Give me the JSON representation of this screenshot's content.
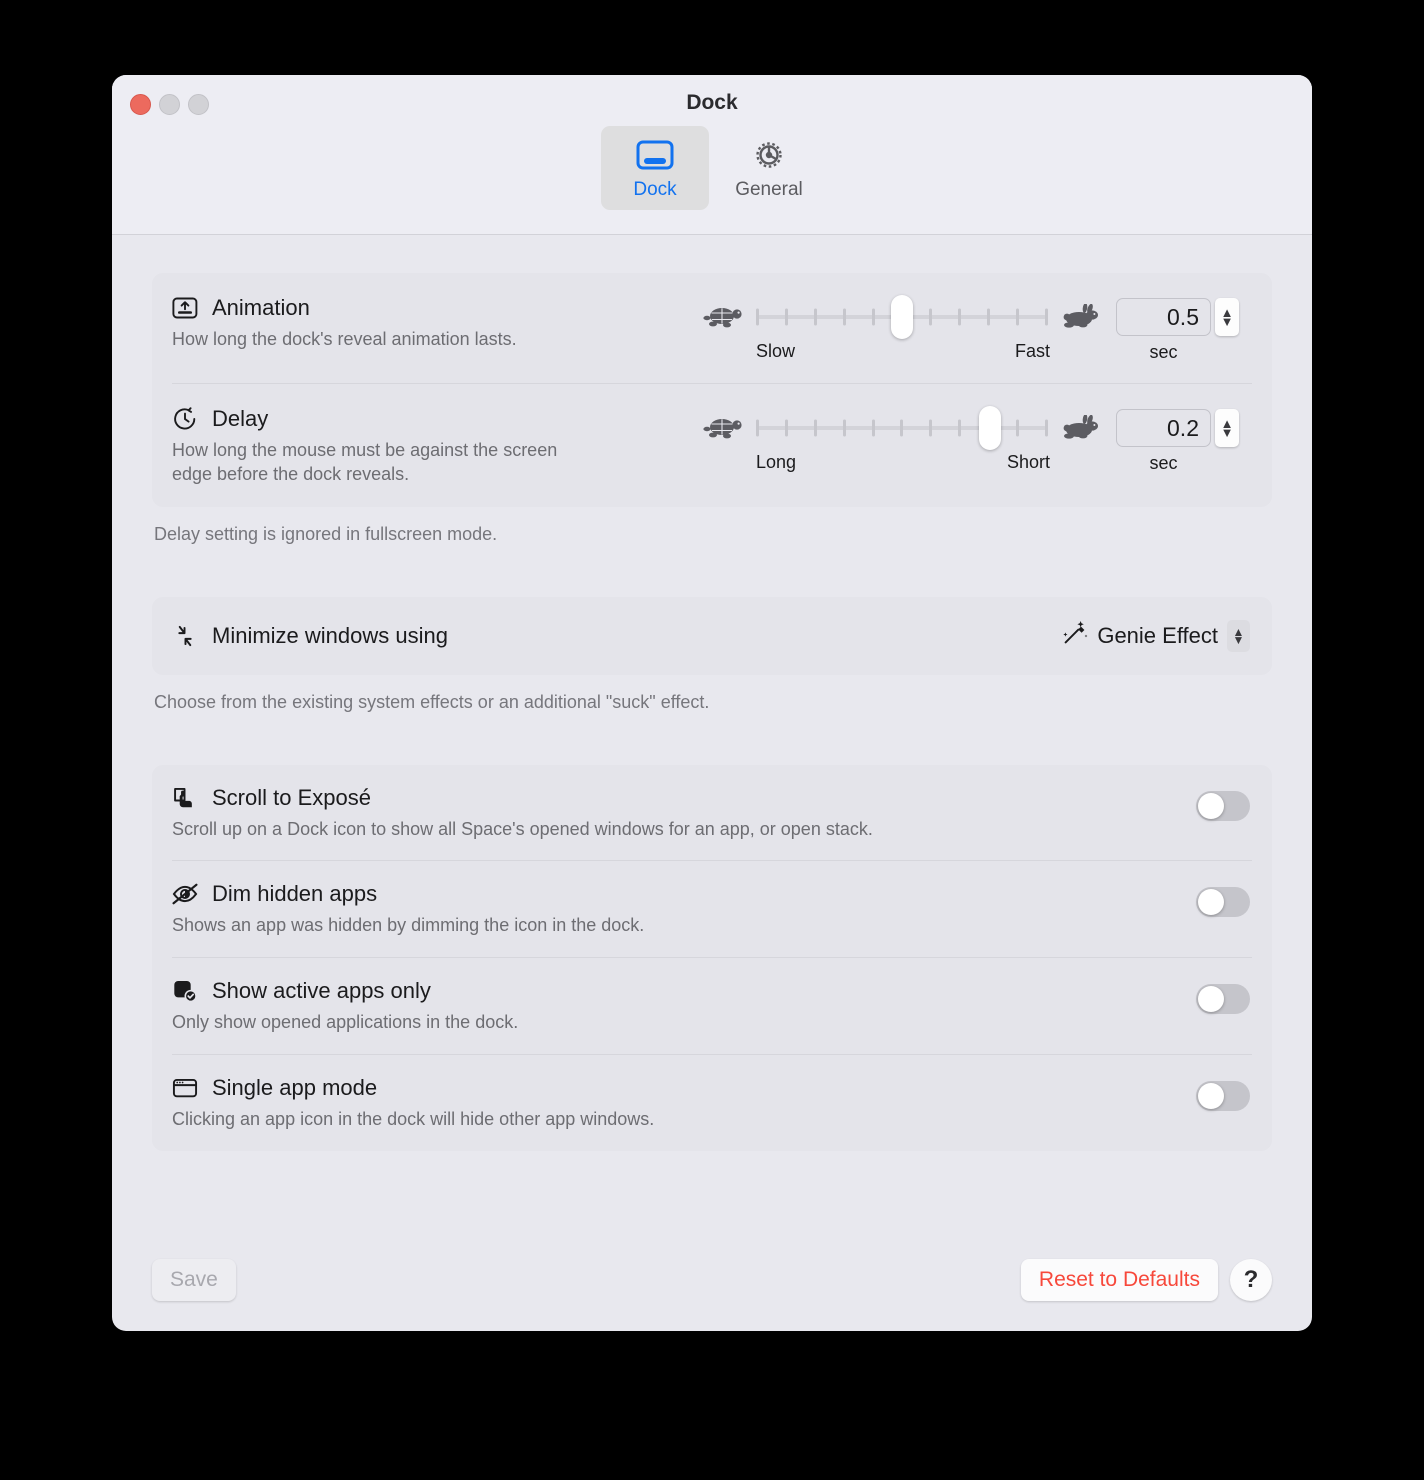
{
  "window": {
    "title": "Dock",
    "traffic_lights": [
      "close",
      "minimize",
      "maximize"
    ]
  },
  "tabs": [
    {
      "label": "Dock",
      "icon": "dock-icon",
      "active": true
    },
    {
      "label": "General",
      "icon": "gear-icon",
      "active": false
    }
  ],
  "settings": {
    "animation": {
      "icon": "reveal-up-icon",
      "title": "Animation",
      "description": "How long the dock's reveal animation lasts.",
      "slider": {
        "left_icon": "turtle-icon",
        "right_icon": "rabbit-icon",
        "left_label": "Slow",
        "right_label": "Fast",
        "ticks": 11,
        "position_index": 5
      },
      "value": "0.5",
      "unit": "sec"
    },
    "delay": {
      "icon": "timer-icon",
      "title": "Delay",
      "description": "How long the mouse must be against the screen edge before the dock reveals.",
      "slider": {
        "left_icon": "turtle-icon",
        "right_icon": "rabbit-icon",
        "left_label": "Long",
        "right_label": "Short",
        "ticks": 11,
        "position_index": 8
      },
      "value": "0.2",
      "unit": "sec"
    },
    "delay_caption": "Delay setting is ignored in fullscreen mode.",
    "minimize": {
      "icon": "minimize-arrows-icon",
      "title": "Minimize windows using",
      "selected": "Genie Effect",
      "value_icon": "magic-wand-icon"
    },
    "minimize_caption": "Choose from the existing system effects or an additional \"suck\" effect."
  },
  "toggles": [
    {
      "icon": "scroll-pointer-icon",
      "title": "Scroll to Exposé",
      "description": "Scroll up on a Dock icon to show all Space's opened windows for an app, or open stack.",
      "on": false
    },
    {
      "icon": "eye-slash-icon",
      "title": "Dim hidden apps",
      "description": "Shows an app was hidden by dimming the icon in the dock.",
      "on": false
    },
    {
      "icon": "app-check-icon",
      "title": "Show active apps only",
      "description": "Only show opened applications in the dock.",
      "on": false
    },
    {
      "icon": "window-icon",
      "title": "Single app mode",
      "description": "Clicking an app icon in the dock will hide other app windows.",
      "on": false
    }
  ],
  "footer": {
    "save_label": "Save",
    "reset_label": "Reset to Defaults",
    "help_label": "?"
  },
  "colors": {
    "accent_blue": "#1272ef",
    "destructive_red": "#f7483b",
    "window_bg": "#e8e8ee",
    "card_bg": "#e4e4ea"
  }
}
